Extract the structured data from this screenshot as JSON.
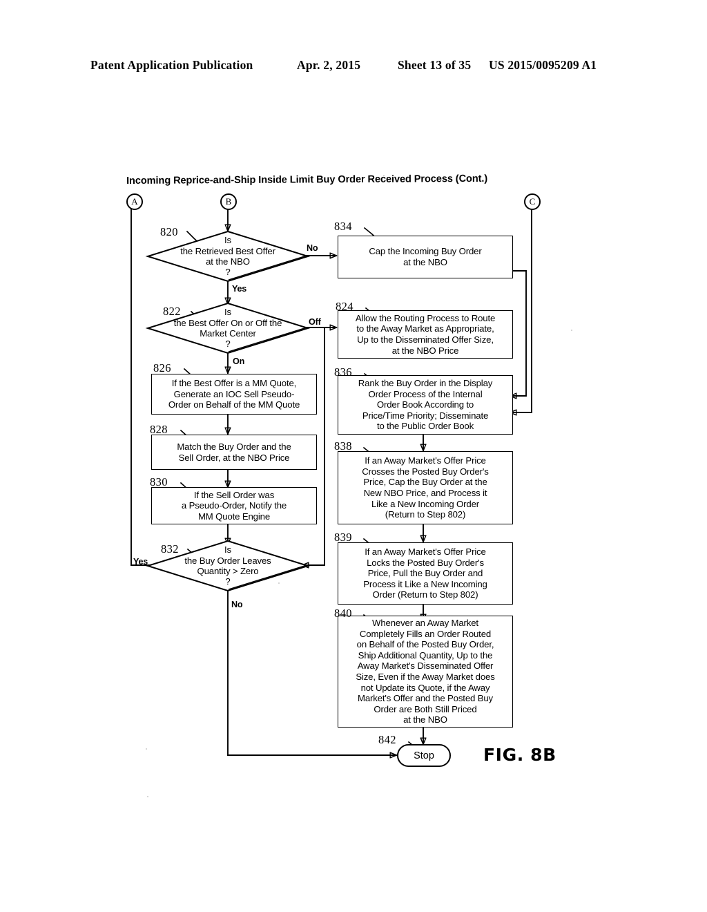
{
  "header": {
    "publication": "Patent Application Publication",
    "date": "Apr. 2, 2015",
    "sheet": "Sheet 13 of 35",
    "number": "US 2015/0095209 A1"
  },
  "figure": {
    "title": "Incoming Reprice-and-Ship Inside Limit Buy Order Received Process (Cont.)",
    "label": "FIG. 8B",
    "colors": {
      "ink": "#000000",
      "paper": "#ffffff"
    }
  },
  "connectors": [
    {
      "id": "A",
      "label": "A"
    },
    {
      "id": "B",
      "label": "B"
    },
    {
      "id": "C",
      "label": "C"
    }
  ],
  "nodes": {
    "n820": {
      "ref": "820",
      "type": "decision",
      "text": "Is\nthe Retrieved Best Offer\nat the NBO\n?",
      "lines": [
        "Is",
        "the Retrieved Best Offer",
        "at the NBO",
        "?"
      ]
    },
    "n822": {
      "ref": "822",
      "type": "decision",
      "text": "Is\nthe Best Offer On or Off the\nMarket Center\n?",
      "lines": [
        "Is",
        "the Best Offer On or Off the",
        "Market Center",
        "?"
      ]
    },
    "n826": {
      "ref": "826",
      "type": "process",
      "lines": [
        "If the Best Offer is a MM Quote,",
        "Generate an IOC Sell Pseudo-",
        "Order on Behalf of the MM Quote"
      ]
    },
    "n828": {
      "ref": "828",
      "type": "process",
      "lines": [
        "Match the Buy Order and the",
        "Sell Order, at the NBO Price"
      ]
    },
    "n830": {
      "ref": "830",
      "type": "process",
      "lines": [
        "If the Sell Order was",
        "a Pseudo-Order, Notify the",
        "MM Quote Engine"
      ]
    },
    "n832": {
      "ref": "832",
      "type": "decision",
      "lines": [
        "Is",
        "the Buy Order Leaves",
        "Quantity > Zero",
        "?"
      ]
    },
    "n834": {
      "ref": "834",
      "type": "process",
      "lines": [
        "Cap the Incoming Buy Order",
        "at the NBO"
      ]
    },
    "n824": {
      "ref": "824",
      "type": "process",
      "lines": [
        "Allow the Routing Process to Route",
        "to the Away Market as Appropriate,",
        "Up to the Disseminated Offer Size,",
        "at the NBO Price"
      ]
    },
    "n836": {
      "ref": "836",
      "type": "process",
      "lines": [
        "Rank the Buy Order in the Display",
        "Order Process of the Internal",
        "Order Book According to",
        "Price/Time Priority; Disseminate",
        "to the Public Order Book"
      ]
    },
    "n838": {
      "ref": "838",
      "type": "process",
      "lines": [
        "If an Away Market's Offer Price",
        "Crosses the Posted Buy Order's",
        "Price, Cap the Buy Order at the",
        "New NBO Price, and Process it",
        "Like a New Incoming Order",
        "(Return to Step 802)"
      ]
    },
    "n839": {
      "ref": "839",
      "type": "process",
      "lines": [
        "If an Away Market's Offer Price",
        "Locks the Posted Buy Order's",
        "Price, Pull the Buy Order and",
        "Process it Like a New Incoming",
        "Order (Return to Step 802)"
      ]
    },
    "n840": {
      "ref": "840",
      "type": "process",
      "lines": [
        "Whenever an Away Market",
        "Completely Fills an Order Routed",
        "on Behalf of the Posted Buy Order,",
        "Ship Additional Quantity, Up to the",
        "Away Market's Disseminated Offer",
        "Size, Even if the Away Market does",
        "not Update its Quote, if the Away",
        "Market's Offer and the Posted Buy",
        "Order are Both Still Priced",
        "at the NBO"
      ]
    },
    "n842": {
      "ref": "842",
      "type": "terminal",
      "label": "Stop"
    }
  },
  "edge_labels": {
    "e820_no": "No",
    "e820_yes": "Yes",
    "e822_off": "Off",
    "e822_on": "On",
    "e832_yes": "Yes",
    "e832_no": "No"
  },
  "flow": [
    {
      "from": "B",
      "to": "820"
    },
    {
      "from": "820",
      "to": "834",
      "label": "No"
    },
    {
      "from": "820",
      "to": "822",
      "label": "Yes"
    },
    {
      "from": "822",
      "to": "824",
      "label": "Off"
    },
    {
      "from": "822",
      "to": "826",
      "label": "On"
    },
    {
      "from": "826",
      "to": "828"
    },
    {
      "from": "828",
      "to": "830"
    },
    {
      "from": "830",
      "to": "832"
    },
    {
      "from": "832",
      "to": "A",
      "label": "Yes"
    },
    {
      "from": "832",
      "to": "842",
      "label": "No"
    },
    {
      "from": "834",
      "to": "836"
    },
    {
      "from": "824",
      "to": "832"
    },
    {
      "from": "C",
      "to": "836"
    },
    {
      "from": "836",
      "to": "838"
    },
    {
      "from": "838",
      "to": "839"
    },
    {
      "from": "839",
      "to": "840"
    },
    {
      "from": "840",
      "to": "842"
    }
  ]
}
